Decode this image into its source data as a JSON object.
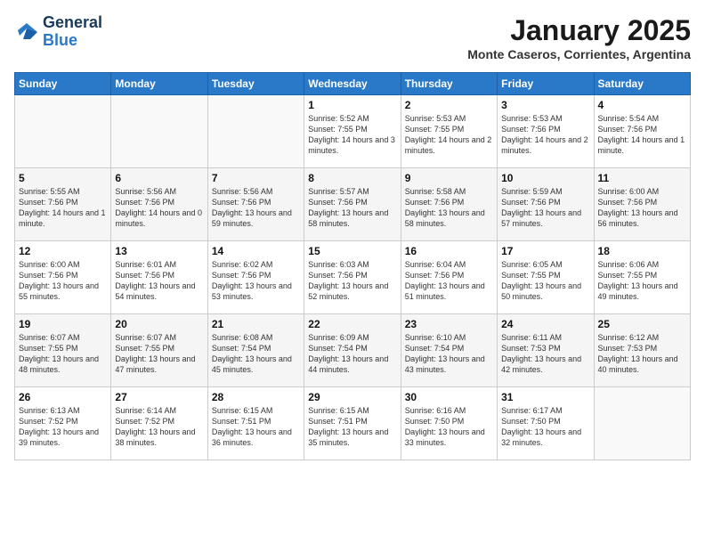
{
  "header": {
    "logo_line1": "General",
    "logo_line2": "Blue",
    "month": "January 2025",
    "location": "Monte Caseros, Corrientes, Argentina"
  },
  "days_of_week": [
    "Sunday",
    "Monday",
    "Tuesday",
    "Wednesday",
    "Thursday",
    "Friday",
    "Saturday"
  ],
  "weeks": [
    [
      {
        "day": "",
        "info": ""
      },
      {
        "day": "",
        "info": ""
      },
      {
        "day": "",
        "info": ""
      },
      {
        "day": "1",
        "info": "Sunrise: 5:52 AM\nSunset: 7:55 PM\nDaylight: 14 hours and 3 minutes."
      },
      {
        "day": "2",
        "info": "Sunrise: 5:53 AM\nSunset: 7:55 PM\nDaylight: 14 hours and 2 minutes."
      },
      {
        "day": "3",
        "info": "Sunrise: 5:53 AM\nSunset: 7:56 PM\nDaylight: 14 hours and 2 minutes."
      },
      {
        "day": "4",
        "info": "Sunrise: 5:54 AM\nSunset: 7:56 PM\nDaylight: 14 hours and 1 minute."
      }
    ],
    [
      {
        "day": "5",
        "info": "Sunrise: 5:55 AM\nSunset: 7:56 PM\nDaylight: 14 hours and 1 minute."
      },
      {
        "day": "6",
        "info": "Sunrise: 5:56 AM\nSunset: 7:56 PM\nDaylight: 14 hours and 0 minutes."
      },
      {
        "day": "7",
        "info": "Sunrise: 5:56 AM\nSunset: 7:56 PM\nDaylight: 13 hours and 59 minutes."
      },
      {
        "day": "8",
        "info": "Sunrise: 5:57 AM\nSunset: 7:56 PM\nDaylight: 13 hours and 58 minutes."
      },
      {
        "day": "9",
        "info": "Sunrise: 5:58 AM\nSunset: 7:56 PM\nDaylight: 13 hours and 58 minutes."
      },
      {
        "day": "10",
        "info": "Sunrise: 5:59 AM\nSunset: 7:56 PM\nDaylight: 13 hours and 57 minutes."
      },
      {
        "day": "11",
        "info": "Sunrise: 6:00 AM\nSunset: 7:56 PM\nDaylight: 13 hours and 56 minutes."
      }
    ],
    [
      {
        "day": "12",
        "info": "Sunrise: 6:00 AM\nSunset: 7:56 PM\nDaylight: 13 hours and 55 minutes."
      },
      {
        "day": "13",
        "info": "Sunrise: 6:01 AM\nSunset: 7:56 PM\nDaylight: 13 hours and 54 minutes."
      },
      {
        "day": "14",
        "info": "Sunrise: 6:02 AM\nSunset: 7:56 PM\nDaylight: 13 hours and 53 minutes."
      },
      {
        "day": "15",
        "info": "Sunrise: 6:03 AM\nSunset: 7:56 PM\nDaylight: 13 hours and 52 minutes."
      },
      {
        "day": "16",
        "info": "Sunrise: 6:04 AM\nSunset: 7:56 PM\nDaylight: 13 hours and 51 minutes."
      },
      {
        "day": "17",
        "info": "Sunrise: 6:05 AM\nSunset: 7:55 PM\nDaylight: 13 hours and 50 minutes."
      },
      {
        "day": "18",
        "info": "Sunrise: 6:06 AM\nSunset: 7:55 PM\nDaylight: 13 hours and 49 minutes."
      }
    ],
    [
      {
        "day": "19",
        "info": "Sunrise: 6:07 AM\nSunset: 7:55 PM\nDaylight: 13 hours and 48 minutes."
      },
      {
        "day": "20",
        "info": "Sunrise: 6:07 AM\nSunset: 7:55 PM\nDaylight: 13 hours and 47 minutes."
      },
      {
        "day": "21",
        "info": "Sunrise: 6:08 AM\nSunset: 7:54 PM\nDaylight: 13 hours and 45 minutes."
      },
      {
        "day": "22",
        "info": "Sunrise: 6:09 AM\nSunset: 7:54 PM\nDaylight: 13 hours and 44 minutes."
      },
      {
        "day": "23",
        "info": "Sunrise: 6:10 AM\nSunset: 7:54 PM\nDaylight: 13 hours and 43 minutes."
      },
      {
        "day": "24",
        "info": "Sunrise: 6:11 AM\nSunset: 7:53 PM\nDaylight: 13 hours and 42 minutes."
      },
      {
        "day": "25",
        "info": "Sunrise: 6:12 AM\nSunset: 7:53 PM\nDaylight: 13 hours and 40 minutes."
      }
    ],
    [
      {
        "day": "26",
        "info": "Sunrise: 6:13 AM\nSunset: 7:52 PM\nDaylight: 13 hours and 39 minutes."
      },
      {
        "day": "27",
        "info": "Sunrise: 6:14 AM\nSunset: 7:52 PM\nDaylight: 13 hours and 38 minutes."
      },
      {
        "day": "28",
        "info": "Sunrise: 6:15 AM\nSunset: 7:51 PM\nDaylight: 13 hours and 36 minutes."
      },
      {
        "day": "29",
        "info": "Sunrise: 6:15 AM\nSunset: 7:51 PM\nDaylight: 13 hours and 35 minutes."
      },
      {
        "day": "30",
        "info": "Sunrise: 6:16 AM\nSunset: 7:50 PM\nDaylight: 13 hours and 33 minutes."
      },
      {
        "day": "31",
        "info": "Sunrise: 6:17 AM\nSunset: 7:50 PM\nDaylight: 13 hours and 32 minutes."
      },
      {
        "day": "",
        "info": ""
      }
    ]
  ]
}
